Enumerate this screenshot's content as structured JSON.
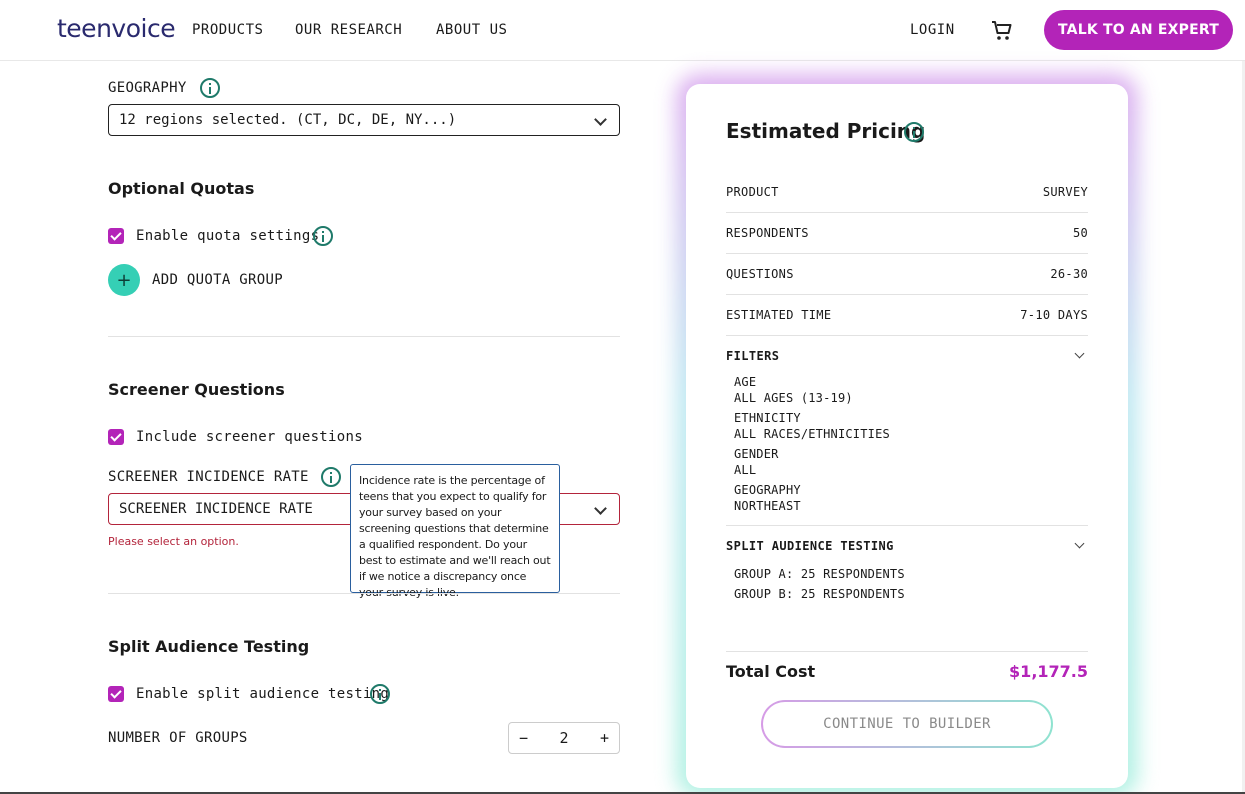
{
  "brand": {
    "logo_text": "teenvoice",
    "accent": "#b324b8",
    "teal": "#35cfb5"
  },
  "nav": {
    "products": "PRODUCTS",
    "research": "OUR RESEARCH",
    "about": "ABOUT US",
    "login": "LOGIN",
    "cta": "TALK TO AN EXPERT"
  },
  "form": {
    "geography": {
      "label": "GEOGRAPHY",
      "value": "12 regions selected. (CT, DC, DE, NY...)"
    },
    "quotas": {
      "title": "Optional Quotas",
      "checkbox_label": "Enable quota settings",
      "add_label": "ADD QUOTA GROUP"
    },
    "screener": {
      "title": "Screener Questions",
      "checkbox_label": "Include screener questions",
      "rate_label": "SCREENER INCIDENCE RATE",
      "rate_placeholder": "SCREENER INCIDENCE RATE",
      "error": "Please select an option.",
      "tooltip": "Incidence rate is the percentage of teens that you expect to qualify for your survey based on your screening questions that determine a qualified respondent. Do your best to estimate and we'll reach out if we notice a discrepancy once your survey is live."
    },
    "split": {
      "title": "Split Audience Testing",
      "checkbox_label": "Enable split audience testing",
      "groups_label": "NUMBER OF GROUPS",
      "groups_value": "2",
      "minus": "−",
      "plus": "+"
    }
  },
  "pricing": {
    "title": "Estimated Pricing",
    "rows": [
      {
        "label": "PRODUCT",
        "value": "SURVEY"
      },
      {
        "label": "RESPONDENTS",
        "value": "50"
      },
      {
        "label": "QUESTIONS",
        "value": "26-30"
      },
      {
        "label": "ESTIMATED TIME",
        "value": "7-10 DAYS"
      }
    ],
    "filters": {
      "title": "FILTERS",
      "items": [
        {
          "name": "AGE",
          "value": "ALL AGES (13-19)"
        },
        {
          "name": "ETHNICITY",
          "value": "ALL RACES/ETHNICITIES"
        },
        {
          "name": "GENDER",
          "value": "ALL"
        },
        {
          "name": "GEOGRAPHY",
          "value": "NORTHEAST"
        }
      ]
    },
    "split": {
      "title": "SPLIT AUDIENCE TESTING",
      "groups": [
        "GROUP A: 25 RESPONDENTS",
        "GROUP B: 25 RESPONDENTS"
      ]
    },
    "total_label": "Total Cost",
    "total_value": "$1,177.5",
    "continue_label": "CONTINUE TO BUILDER"
  }
}
